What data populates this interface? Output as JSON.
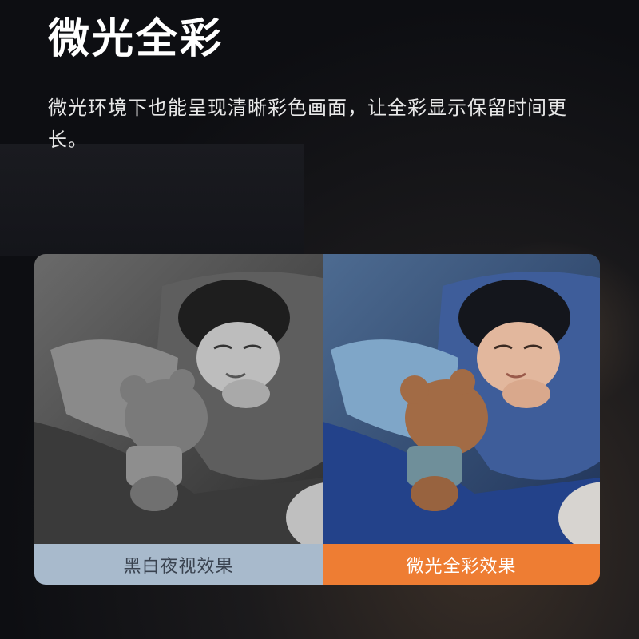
{
  "header": {
    "title": "微光全彩",
    "description": "微光环境下也能呈现清晰彩色画面，让全彩显示保留时间更长。"
  },
  "comparison": {
    "left": {
      "label": "黑白夜视效果",
      "mode": "grayscale",
      "label_bg": "#a8bacc",
      "label_color": "#3a4350"
    },
    "right": {
      "label": "微光全彩效果",
      "mode": "color",
      "label_bg": "#ee7d33",
      "label_color": "#ffffff"
    }
  }
}
